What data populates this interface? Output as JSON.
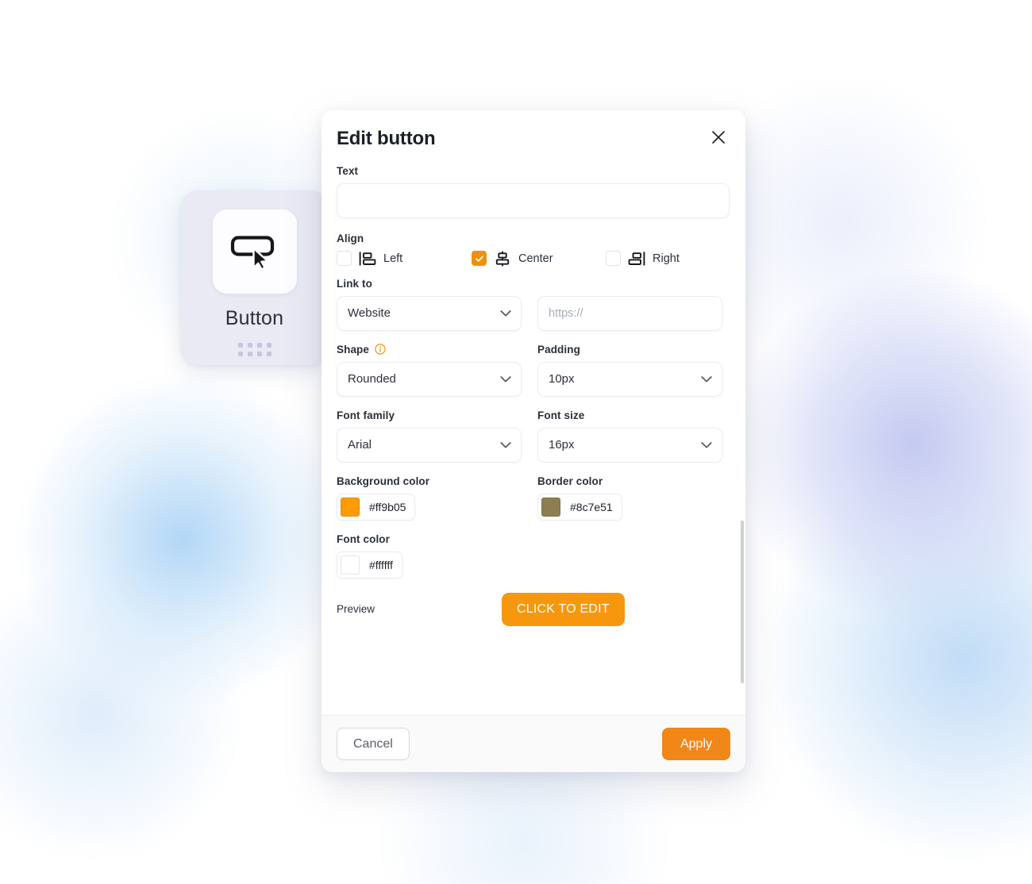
{
  "widget": {
    "label": "Button",
    "icon": "button-cursor-icon",
    "drag_handle": "drag-dots",
    "card_color": "#e9eaf4",
    "tile_color": "#fdfdff"
  },
  "dialog": {
    "title": "Edit button",
    "close_icon": "close-icon",
    "text": {
      "label": "Text",
      "value": "",
      "placeholder": ""
    },
    "align": {
      "label": "Align",
      "options": [
        {
          "label": "Left",
          "icon": "align-left-icon",
          "checked": false
        },
        {
          "label": "Center",
          "icon": "align-center-icon",
          "checked": true
        },
        {
          "label": "Right",
          "icon": "align-right-icon",
          "checked": false
        }
      ]
    },
    "link_to": {
      "label": "Link to",
      "type_value": "Website",
      "url_value": "",
      "url_placeholder": "https://"
    },
    "shape": {
      "label": "Shape",
      "info_icon": "info-icon",
      "value": "Rounded"
    },
    "padding": {
      "label": "Padding",
      "value": "10px"
    },
    "font_family": {
      "label": "Font family",
      "value": "Arial"
    },
    "font_size": {
      "label": "Font size",
      "value": "16px"
    },
    "background_color": {
      "label": "Background color",
      "value": "#ff9b05"
    },
    "border_color": {
      "label": "Border color",
      "value": "#8c7e51"
    },
    "font_color": {
      "label": "Font color",
      "value": "#ffffff"
    },
    "preview": {
      "label": "Preview",
      "button_text": "CLICK TO EDIT",
      "button_bg": "#f7970d",
      "button_fg": "#ffffff"
    },
    "footer": {
      "cancel_label": "Cancel",
      "apply_label": "Apply",
      "apply_bg": "#f18619"
    }
  }
}
